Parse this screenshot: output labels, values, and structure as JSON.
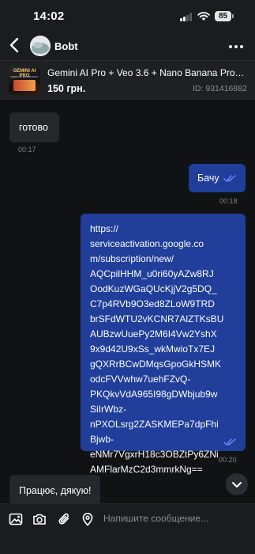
{
  "status_bar": {
    "time": "14:02",
    "battery": "85"
  },
  "header": {
    "contact_name": "Bobt"
  },
  "listing": {
    "title": "Gemini AI Pro + Veo 3.6 + Nano Banana Pro +…",
    "price": "150 грн.",
    "id": "ID: 931416882",
    "thumb_title": "GEMINI AI PRO",
    "thumb_subtitle": "ПІДПИСКА ДЛЯ ВАШОГО ОСОБИСТОГО АКАУНТУ"
  },
  "messages": [
    {
      "direction": "in",
      "text": "готово",
      "time": "00:17"
    },
    {
      "direction": "out",
      "text": "Бачу",
      "time": "00:18",
      "status": "read"
    },
    {
      "direction": "out",
      "lines": [
        "https://",
        "serviceactivation.google.co",
        "m/subscription/new/",
        "AQCpilHHM_u0ri60yAZw8RJ",
        "OodKuzWGaQUcKjjV2g5DQ_",
        "C7p4RVb9O3ed8ZLoW9TRD",
        "brSFdWTU2vKCNR7AlZTKsBU",
        "AUBzwUuePy2M6I4Vw2YshX",
        "9x9d42U9xSs_wkMwioTx7EJ",
        "gQXRrBCwDMqsGpoGkHSMK",
        "odcFVVwhw7uehFZvQ-",
        "PKQkvVdA965I98gDWbjub9w",
        "SiIrWbz-",
        "nPXOLsrg2ZASKMEPa7dpFhi",
        "Bjwb-",
        "eNMr7VgxrH18c3OBZtPy6ZNi",
        "AMFlarMzC2d3mmrkNg=="
      ],
      "time": "00:20",
      "status": "read"
    },
    {
      "direction": "in",
      "text": "Працює, дякую!"
    }
  ],
  "composer": {
    "placeholder": "Напишите сообщение..."
  },
  "colors": {
    "outgoing_bubble": "#203e9a",
    "incoming_bubble": "#25272b",
    "read_ticks": "#6c8cff",
    "background": "#111214"
  }
}
